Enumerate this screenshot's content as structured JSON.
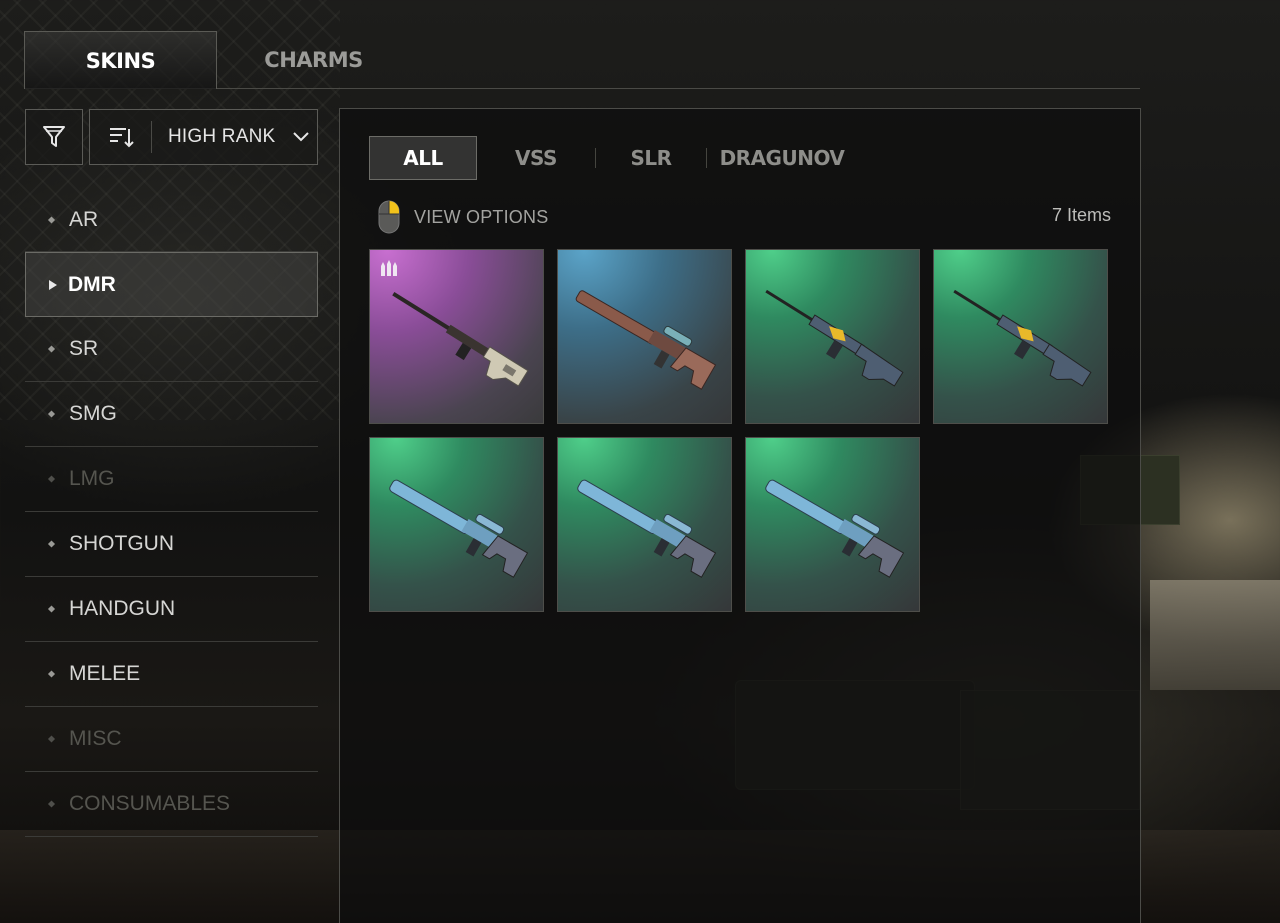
{
  "top_tabs": {
    "skins": "SKINS",
    "charms": "CHARMS"
  },
  "toolbar": {
    "sort_label": "HIGH RANK"
  },
  "categories": [
    {
      "label": "AR",
      "state": "normal"
    },
    {
      "label": "DMR",
      "state": "active"
    },
    {
      "label": "SR",
      "state": "normal"
    },
    {
      "label": "SMG",
      "state": "normal"
    },
    {
      "label": "LMG",
      "state": "disabled"
    },
    {
      "label": "SHOTGUN",
      "state": "normal"
    },
    {
      "label": "HANDGUN",
      "state": "normal"
    },
    {
      "label": "MELEE",
      "state": "normal"
    },
    {
      "label": "MISC",
      "state": "disabled"
    },
    {
      "label": "CONSUMABLES",
      "state": "disabled"
    }
  ],
  "sub_tabs": {
    "all": "ALL",
    "vss": "VSS",
    "slr": "SLR",
    "dragunov": "DRAGUNOV"
  },
  "view_options": {
    "label": "VIEW OPTIONS"
  },
  "item_count": "7 Items",
  "items": [
    {
      "weapon": "dragunov-rifle-icon",
      "rarity_color": "#b45fc0",
      "rank_badge": true
    },
    {
      "weapon": "vss-rifle-icon",
      "rarity_color": "#4f96bc",
      "rank_badge": false
    },
    {
      "weapon": "slr-rifle-icon",
      "rarity_color": "#3fb878",
      "rank_badge": false
    },
    {
      "weapon": "slr-rifle-icon",
      "rarity_color": "#3fb878",
      "rank_badge": false
    },
    {
      "weapon": "vss-rifle-icon",
      "rarity_color": "#3fb878",
      "rank_badge": false
    },
    {
      "weapon": "vss-rifle-icon",
      "rarity_color": "#3fb878",
      "rank_badge": false
    },
    {
      "weapon": "vss-rifle-icon",
      "rarity_color": "#3fb878",
      "rank_badge": false
    }
  ]
}
